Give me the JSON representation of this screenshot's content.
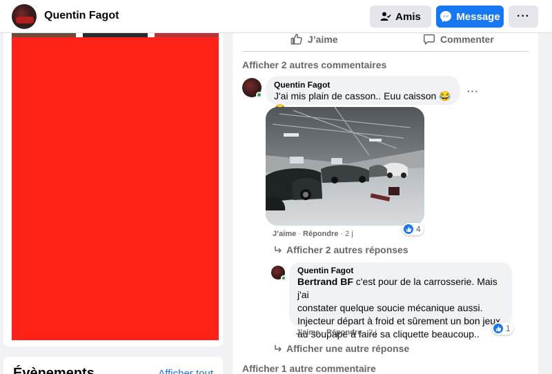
{
  "header": {
    "page_name": "Quentin Fagot",
    "friends_label": "Amis",
    "message_label": "Message",
    "more_label": "···"
  },
  "events": {
    "title": "Évènements",
    "see_all": "Afficher tout"
  },
  "post": {
    "like_label": "J’aime",
    "comment_label": "Commenter",
    "show_more_comments_top": "Afficher 2 autres commentaires",
    "show_more_comments_bottom": "Afficher 1 autre commentaire"
  },
  "comment1": {
    "author": "Quentin Fagot",
    "text": "J'ai mis plain de casson.. Euu caisson",
    "emoji": "😂😂",
    "like": "J’aime",
    "reply": "Répondre",
    "time": "2 j",
    "reaction_count": "4",
    "replies_link": "Afficher 2 autres réponses"
  },
  "reply1": {
    "author": "Quentin Fagot",
    "mention": "Bertrand BF",
    "line1": " c'est pour de la carrosserie. Mais j'ai",
    "line2": "constater quelque souciе mécanique aussi.",
    "line3": "Injecteur départ à froid et sûrement un bon jeux",
    "line4": "au soupape à faire sa cliquette beaucoup..",
    "like": "J’aime",
    "reply": "Répondre",
    "time": "2 j",
    "reaction_count": "1",
    "more_replies": "Afficher une autre réponse"
  },
  "colors": {
    "accent": "#1877f2",
    "redacted": "#fe2219",
    "online": "#31a24c"
  }
}
